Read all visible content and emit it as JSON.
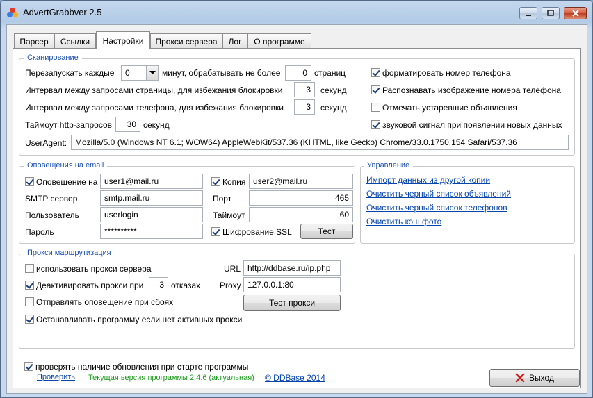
{
  "window": {
    "title": "AdvertGrabbver 2.5"
  },
  "tabs": [
    "Парсер",
    "Ссылки",
    "Настройки",
    "Прокси сервера",
    "Лог",
    "О программе"
  ],
  "scan": {
    "legend": "Сканирование",
    "restart_label": "Перезапускать каждые",
    "restart_value": "0",
    "minutes_label": "минут, обрабатывать не более",
    "max_pages_value": "0",
    "pages_label": "страниц",
    "page_interval_label": "Интервал между запросами страницы, для избежания блокировки",
    "page_interval_value": "3",
    "phone_interval_label": "Интервал между запросами телефона, для избежания блокировки",
    "phone_interval_value": "3",
    "seconds_label": "секунд",
    "timeout_label": "Таймоут http-запросов",
    "timeout_value": "30",
    "useragent_label": "UserAgent:",
    "useragent_value": "Mozilla/5.0 (Windows NT 6.1; WOW64) AppleWebKit/537.36 (KHTML, like Gecko) Chrome/33.0.1750.154 Safari/537.36",
    "options": [
      {
        "label": "форматировать номер телефона",
        "checked": true
      },
      {
        "label": "Распознавать изображение номера телефона",
        "checked": true
      },
      {
        "label": "Отмечать устаревшие объявления",
        "checked": false
      },
      {
        "label": "звуковой сигнал при появлении новых данных",
        "checked": true
      }
    ]
  },
  "notify": {
    "legend": "Оповещения на email",
    "notify_label": "Оповещение на",
    "notify_checked": true,
    "notify_value": "user1@mail.ru",
    "copy_label": "Копия",
    "copy_checked": true,
    "copy_value": "user2@mail.ru",
    "smtp_label": "SMTP сервер",
    "smtp_value": "smtp.mail.ru",
    "port_label": "Порт",
    "port_value": "465",
    "user_label": "Пользователь",
    "user_value": "userlogin",
    "timeout_label": "Таймоут",
    "timeout_value": "60",
    "password_label": "Пароль",
    "password_value": "**********",
    "ssl_label": "Шифрование SSL",
    "ssl_checked": true,
    "test_label": "Тест"
  },
  "manage": {
    "legend": "Управление",
    "links": [
      "Импорт данных из другой копии",
      "Очистить черный список объявлений",
      "Очистить черный список телефонов",
      "Очистить кэш фото"
    ]
  },
  "proxy": {
    "legend": "Прокси маршрутизация",
    "use_label": "использовать прокси сервера",
    "use_checked": false,
    "deactivate_label": "Деактивировать прокси при",
    "deactivate_checked": true,
    "deactivate_value": "3",
    "failures_label": "отказах",
    "notify_label": "Отправлять оповещение при сбоях",
    "notify_checked": false,
    "stop_label": "Останавливать программу если нет активных прокси",
    "stop_checked": true,
    "url_label": "URL",
    "url_value": "http://ddbase.ru/ip.php",
    "proxy_label": "Proxy",
    "proxy_value": "127.0.0.1:80",
    "test_label": "Тест прокси"
  },
  "update": {
    "label": "проверять наличие обновления при старте программы",
    "checked": true,
    "check_link": "Проверить",
    "separator": "|",
    "version_text": "Текущая версия программы 2.4.6 (актуальная)"
  },
  "footer": {
    "copyright": "© DDBase 2014",
    "exit_label": "Выход"
  },
  "colors": {
    "accent": "#1e50b4",
    "version_green": "#1e9c1e",
    "link": "#0645ad",
    "exit_icon": "#cc1f1f"
  }
}
